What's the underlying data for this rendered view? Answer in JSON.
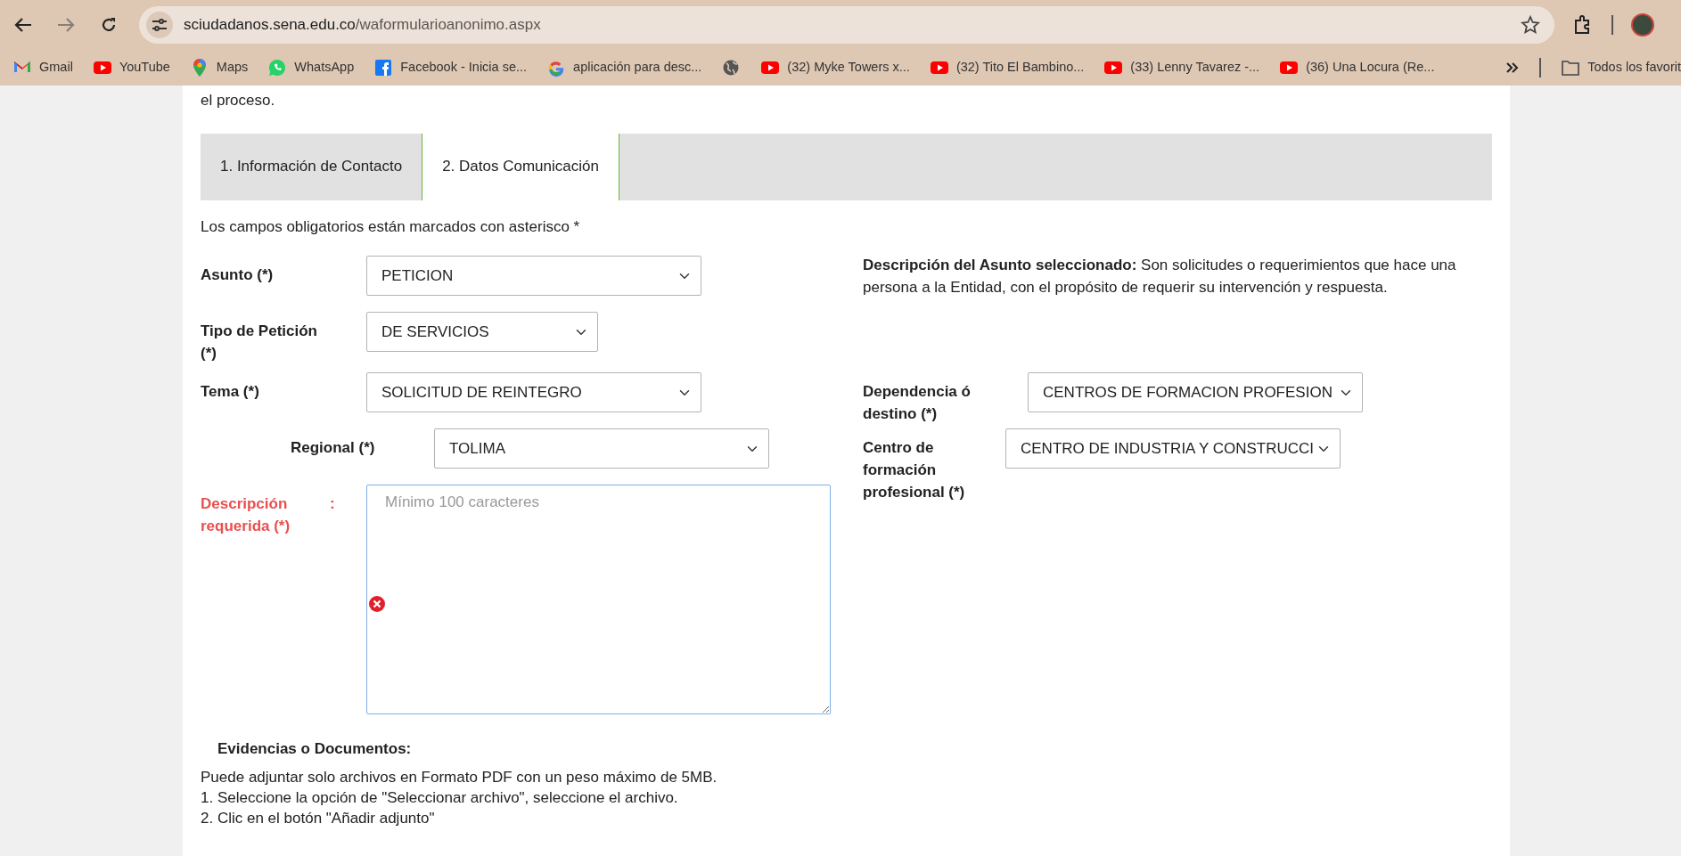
{
  "browser": {
    "url_host": "sciudadanos.sena.edu.co",
    "url_path": "/waformularioanonimo.aspx",
    "bookmarks": [
      {
        "kind": "mail",
        "label": "Gmail"
      },
      {
        "kind": "video",
        "label": "YouTube"
      },
      {
        "kind": "pin",
        "label": "Maps"
      },
      {
        "kind": "chat",
        "label": "WhatsApp"
      },
      {
        "kind": "social",
        "label": "Facebook - Inicia se..."
      },
      {
        "kind": "search",
        "label": "aplicación para desc..."
      },
      {
        "kind": "globe"
      },
      {
        "kind": "video",
        "label": "(32) Myke Towers x..."
      },
      {
        "kind": "video",
        "label": "(32) Tito El Bambino..."
      },
      {
        "kind": "video",
        "label": "(33) Lenny Tavarez -..."
      },
      {
        "kind": "video",
        "label": "(36) Una Locura (Re..."
      }
    ],
    "all_bookmarks": "Todos los favorit"
  },
  "intro_text": "el proceso.",
  "tabs": [
    {
      "label": "1. Información de Contacto",
      "selected": false
    },
    {
      "label": "2. Datos Comunicación",
      "selected": true
    }
  ],
  "required_note": "Los campos obligatorios están marcados con asterisco *",
  "rows": [
    {
      "left": {
        "label": "Asunto (*)",
        "value": "PETICION"
      },
      "right": {
        "kind": "text",
        "text": "**Descripción del Asunto seleccionado:** Son solicitudes o requerimientos que hace una persona a la Entidad, con el propósito de requerir su intervención y respuesta."
      }
    },
    {
      "left": {
        "label": "Tipo de Petición (*)",
        "value": "DE SERVICIOS"
      }
    },
    {
      "left": {
        "label": "Tema (*)",
        "value": "SOLICITUD DE REINTEGRO"
      },
      "right": {
        "kind": "select",
        "label": "Dependencia ó destino (*)",
        "value": "CENTROS DE FORMACION PROFESION"
      }
    },
    {
      "left": {
        "label": "Regional (*)",
        "value": "TOLIMA"
      },
      "right": {
        "kind": "select",
        "label": "Centro de formación profesional (*)",
        "value": "CENTRO DE INDUSTRIA Y CONSTRUCCI"
      }
    }
  ],
  "description": {
    "label": "Descripción",
    "colon": ":",
    "label_line2": "requerida (*)",
    "placeholder": "Mínimo 100 caracteres",
    "invalid": true
  },
  "evidence": {
    "heading": "Evidencias o Documentos:",
    "lines": [
      "Puede adjuntar solo archivos en Formato PDF con un peso máximo de 5MB.",
      "1. Seleccione la opción de \"Seleccionar archivo\", seleccione el archivo.",
      "2. Clic en el botón \"Añadir adjunto\""
    ]
  }
}
